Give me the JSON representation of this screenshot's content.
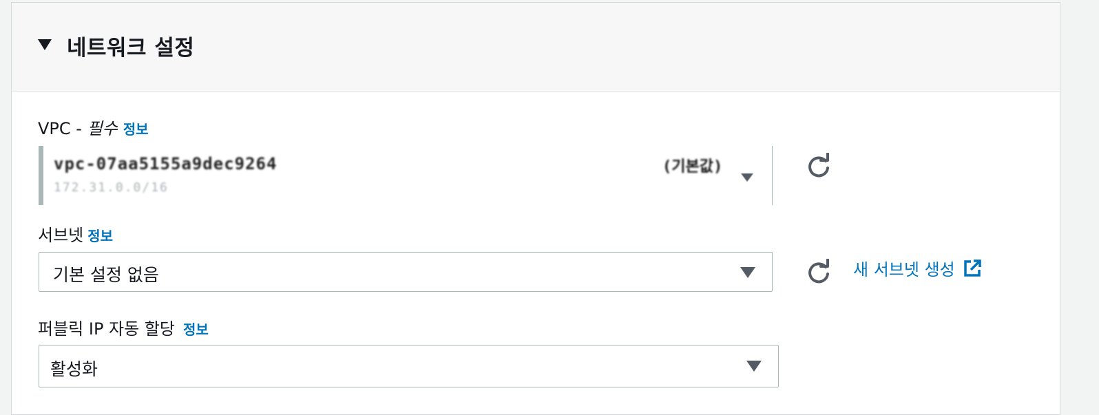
{
  "section": {
    "title": "네트워크 설정"
  },
  "vpc": {
    "label": "VPC - ",
    "required": "필수",
    "info": "정보",
    "selected_id": "vpc-07aa5155a9dec9264",
    "selected_cidr": "172.31.0.0/16",
    "selected_name": "(기본값)"
  },
  "subnet": {
    "label": "서브넷",
    "info": "정보",
    "value": "기본 설정 없음",
    "create_link": "새 서브넷 생성"
  },
  "public_ip": {
    "label": "퍼블릭 IP 자동 할당",
    "info": "정보",
    "value": "활성화"
  },
  "colors": {
    "link": "#0073bb",
    "text": "#16191f",
    "border": "#aab7b8",
    "icon": "#545b64"
  },
  "icons": {
    "collapse": "caret-down-icon",
    "refresh": "refresh-icon",
    "external": "external-link-icon",
    "dropdown": "caret-down-icon"
  }
}
